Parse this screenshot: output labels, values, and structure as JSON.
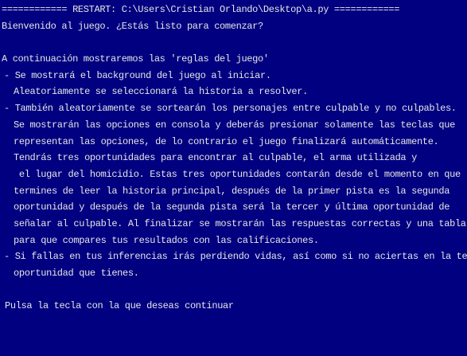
{
  "console": {
    "restart_banner": "============ RESTART: C:\\Users\\Cristian Orlando\\Desktop\\a.py ============",
    "welcome": "Bienvenido al juego. ¿Estás listo para comenzar?",
    "rules_intro": "A continuación mostraremos las 'reglas del juego'",
    "rules": [
      {
        "lines": [
          "- Se mostrará el background del juego al iniciar.",
          "Aleatoriamente se seleccionará la historia a resolver."
        ]
      },
      {
        "lines": [
          "- También aleatoriamente se sortearán los personajes entre culpable y no culpables.",
          "Se mostrarán las opciones en consola y deberás presionar solamente las teclas que",
          "representan las opciones, de lo contrario el juego finalizará automáticamente.",
          "Tendrás tres oportunidades para encontrar al culpable, el arma utilizada y",
          " el lugar del homicidio. Estas tres oportunidades contarán desde el momento en que",
          "termines de leer la historia principal, después de la primer pista es la segunda",
          "oportunidad y después de la segunda pista será la tercer y última oportunidad de",
          "señalar al culpable. Al finalizar se mostrarán las respuestas correctas y una tabla",
          "para que compares tus resultados con las calificaciones."
        ]
      },
      {
        "lines": [
          "- Si fallas en tus inferencias irás perdiendo vidas, así como si no aciertas en la tercer",
          "oportunidad que tienes."
        ]
      }
    ],
    "prompt": "Pulsa la tecla con la que deseas continuar"
  }
}
